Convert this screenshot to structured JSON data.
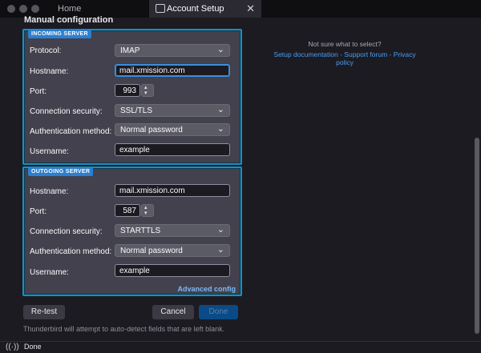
{
  "tabs": {
    "home": "Home",
    "active": "Account Setup",
    "close": "✕"
  },
  "heading": "Manual configuration",
  "incoming": {
    "badge": "INCOMING SERVER",
    "protocol_label": "Protocol:",
    "protocol_value": "IMAP",
    "hostname_label": "Hostname:",
    "hostname_value": "mail.xmission.com",
    "port_label": "Port:",
    "port_value": "993",
    "security_label": "Connection security:",
    "security_value": "SSL/TLS",
    "auth_label": "Authentication method:",
    "auth_value": "Normal password",
    "username_label": "Username:",
    "username_value": "example"
  },
  "outgoing": {
    "badge": "OUTGOING SERVER",
    "hostname_label": "Hostname:",
    "hostname_value": "mail.xmission.com",
    "port_label": "Port:",
    "port_value": "587",
    "security_label": "Connection security:",
    "security_value": "STARTTLS",
    "auth_label": "Authentication method:",
    "auth_value": "Normal password",
    "username_label": "Username:",
    "username_value": "example",
    "advanced": "Advanced config"
  },
  "info": {
    "question": "Not sure what to select?",
    "links": "Setup documentation - Support forum - Privacy policy"
  },
  "buttons": {
    "retest": "Re-test",
    "cancel": "Cancel",
    "done": "Done"
  },
  "hint": "Thunderbird will attempt to auto-detect fields that are left blank.",
  "status": {
    "icon": "((·))",
    "text": "Done"
  },
  "icons": {
    "chevron": "⌄",
    "up": "▴",
    "down": "▾"
  },
  "colors": {
    "accent": "#1b8fbf",
    "badge": "#2b7fd0",
    "link": "#4b9ef0",
    "done_button": "#0a4a86"
  }
}
